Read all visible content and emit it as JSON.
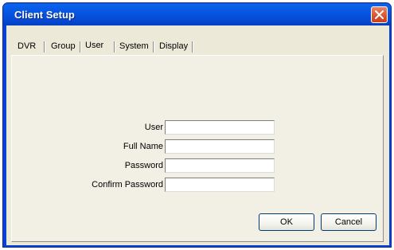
{
  "window": {
    "title": "Client Setup"
  },
  "tabs": [
    {
      "label": "DVR"
    },
    {
      "label": "Group"
    },
    {
      "label": "User"
    },
    {
      "label": "System"
    },
    {
      "label": "Display"
    }
  ],
  "active_tab": "User",
  "form": {
    "user_label": "User",
    "user_value": "",
    "full_name_label": "Full Name",
    "full_name_value": "",
    "password_label": "Password",
    "password_value": "",
    "confirm_password_label": "Confirm Password",
    "confirm_password_value": ""
  },
  "buttons": {
    "ok_label": "OK",
    "cancel_label": "Cancel"
  },
  "colors": {
    "titlebar": "#0553e0",
    "close_button": "#d8522e",
    "dialog_face": "#ece9d8"
  }
}
